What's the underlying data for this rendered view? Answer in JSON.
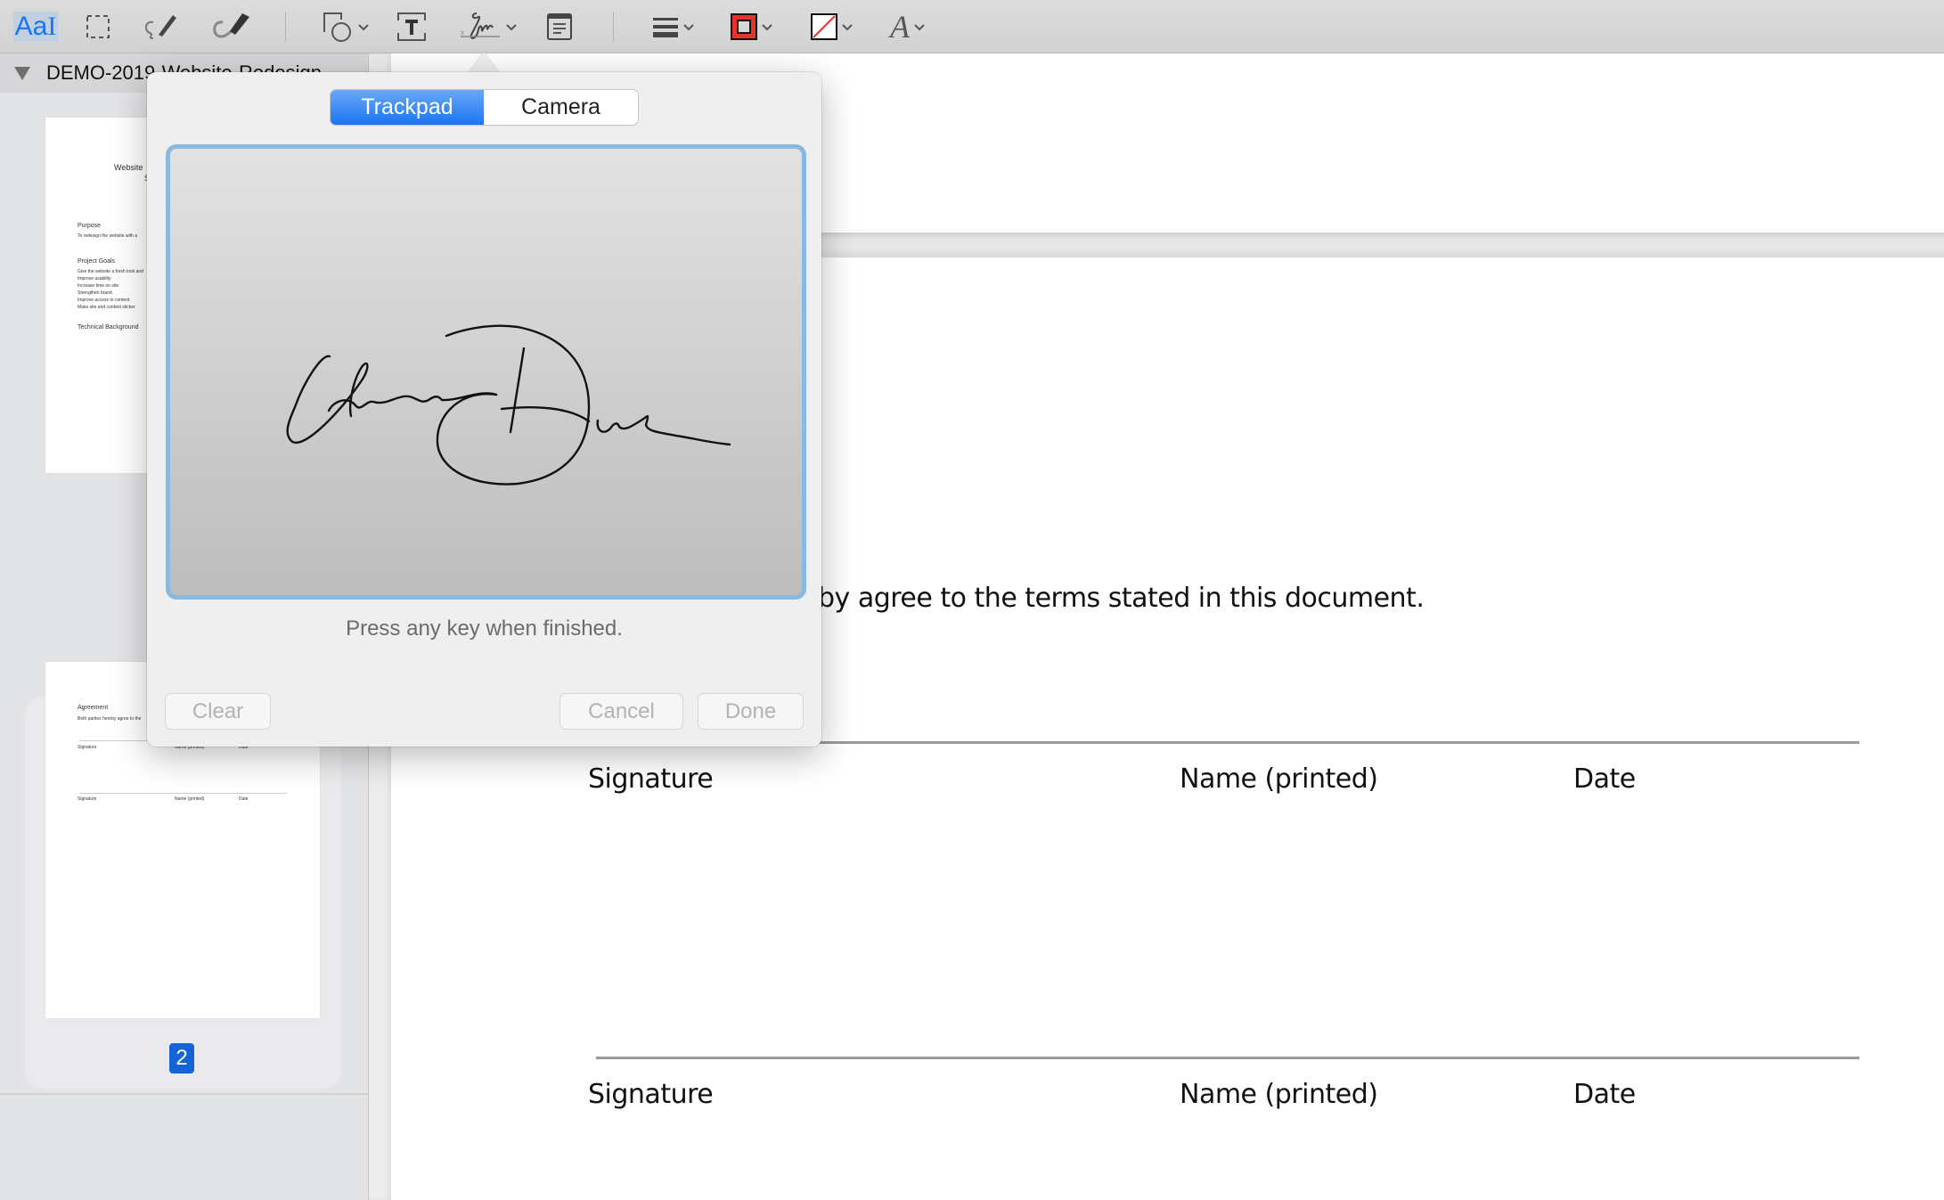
{
  "toolbar": {
    "items": [
      {
        "name": "text-selection-tool",
        "icon": "text-cursor-icon",
        "active": true
      },
      {
        "name": "rectangular-selection-tool",
        "icon": "dashed-rect-icon"
      },
      {
        "name": "sketch-tool",
        "icon": "pen-sketch-icon"
      },
      {
        "name": "draw-tool",
        "icon": "marker-draw-icon"
      },
      {
        "name": "shapes-tool",
        "icon": "shapes-icon",
        "has_menu": true
      },
      {
        "name": "text-box-tool",
        "icon": "text-box-icon"
      },
      {
        "name": "sign-tool",
        "icon": "signature-icon",
        "has_menu": true,
        "active": true
      },
      {
        "name": "note-tool",
        "icon": "note-icon"
      },
      {
        "name": "shape-style-tool",
        "icon": "line-style-icon",
        "has_menu": true
      },
      {
        "name": "border-color-tool",
        "icon": "border-color-icon",
        "has_menu": true
      },
      {
        "name": "fill-color-tool",
        "icon": "fill-color-icon",
        "has_menu": true
      },
      {
        "name": "text-style-tool",
        "icon": "font-icon",
        "has_menu": true
      }
    ],
    "text_tool_glyph": "Aa",
    "colors": {
      "accent": "#1a75f3",
      "border_color": "#e8322a",
      "fill_slash": "#e8322a"
    }
  },
  "sidebar": {
    "document_title": "DEMO-2019-Website-Redesign",
    "thumbnails": [
      {
        "page": 1,
        "lines": [
          "Website",
          "S",
          "Purpose",
          "To redesign the website with a",
          "Project Goals",
          "Give the website a fresh look and",
          "Improve usability",
          "Increase time on site",
          "Strengthen brand",
          "Improve access to content",
          "Make site and content sticker",
          "Technical Background"
        ]
      },
      {
        "page": 2,
        "selected": true,
        "lines": [
          "Agreement",
          "Both parties hereby agree to the",
          "Signature",
          "Name (printed)",
          "Date",
          "Signature",
          "Name (printed)",
          "Date"
        ]
      }
    ],
    "selected_page_label": "2"
  },
  "document": {
    "agreement_text_visible": "by agree to the terms stated in this document.",
    "signature_blocks": [
      {
        "signature_label": "Signature",
        "name_label": "Name (printed)",
        "date_label": "Date"
      },
      {
        "signature_label": "Signature",
        "name_label": "Name (printed)",
        "date_label": "Date"
      }
    ]
  },
  "signature_popover": {
    "tabs": [
      {
        "label": "Trackpad",
        "selected": true
      },
      {
        "label": "Camera",
        "selected": false
      }
    ],
    "signature_drawn": "James Doe (handwritten)",
    "hint": "Press any key when finished.",
    "buttons": {
      "clear": {
        "label": "Clear",
        "enabled": false
      },
      "cancel": {
        "label": "Cancel",
        "enabled": false
      },
      "done": {
        "label": "Done",
        "enabled": false
      }
    }
  }
}
